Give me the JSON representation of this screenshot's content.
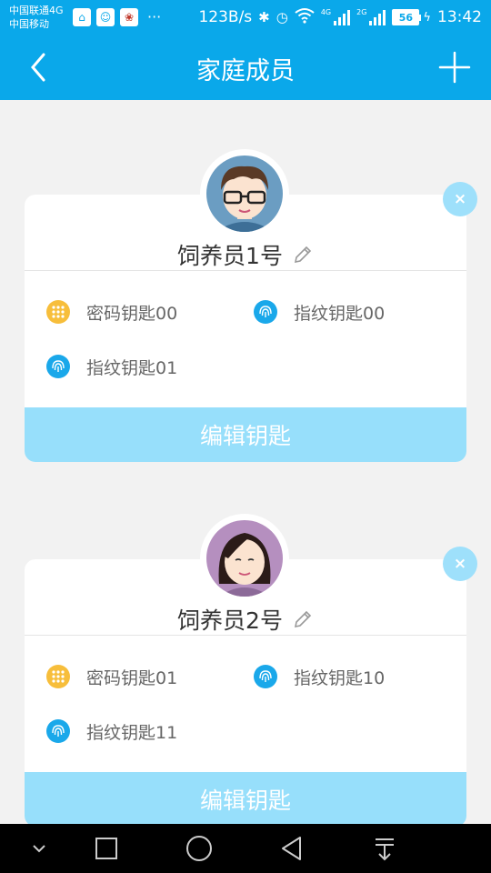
{
  "status_bar": {
    "carrier_1": "中国联通4G",
    "carrier_2": "中国移动",
    "speed": "123B/s",
    "net_1": "4G",
    "net_2": "2G",
    "battery": "56",
    "time": "13:42"
  },
  "header": {
    "title": "家庭成员",
    "back_icon": "chevron-left-icon",
    "add_icon": "plus-icon"
  },
  "members": [
    {
      "name": "饲养员1号",
      "keys": [
        {
          "type": "password",
          "label": "密码钥匙00"
        },
        {
          "type": "fingerprint",
          "label": "指纹钥匙00"
        },
        {
          "type": "fingerprint",
          "label": "指纹钥匙01"
        }
      ],
      "edit_keys_label": "编辑钥匙",
      "delete_label": "×"
    },
    {
      "name": "饲养员2号",
      "keys": [
        {
          "type": "password",
          "label": "密码钥匙01"
        },
        {
          "type": "fingerprint",
          "label": "指纹钥匙10"
        },
        {
          "type": "fingerprint",
          "label": "指纹钥匙11"
        }
      ],
      "edit_keys_label": "编辑钥匙",
      "delete_label": "×"
    }
  ],
  "colors": {
    "primary": "#0aa8ea",
    "button_light": "#97dffb",
    "password_icon": "#f7be3b",
    "fingerprint_icon": "#1aa8ea"
  }
}
